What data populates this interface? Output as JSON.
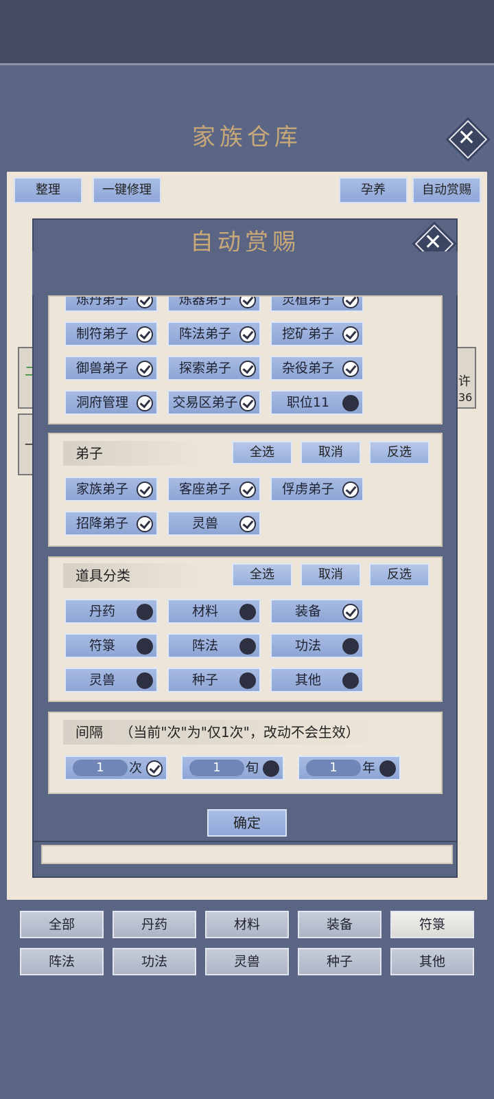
{
  "warehouse": {
    "title": "家族仓库",
    "toolbar": {
      "tidy": "整理",
      "repair": "一键修理",
      "breed": "孕养",
      "auto_reward": "自动赏赐"
    },
    "behind_text": {
      "left1": "二",
      "left2": "一",
      "right1": "许",
      "right2": "36"
    },
    "tabs_row1": [
      "全部",
      "丹药",
      "材料",
      "装备",
      "符箓"
    ],
    "tabs_row2": [
      "阵法",
      "功法",
      "灵兽",
      "种子",
      "其他"
    ],
    "selected_tab": "符箓"
  },
  "dialog": {
    "title": "自动赏赐",
    "positions": [
      {
        "label": "炼丹弟子",
        "checked": true
      },
      {
        "label": "炼器弟子",
        "checked": true
      },
      {
        "label": "灵植弟子",
        "checked": true
      },
      {
        "label": "制符弟子",
        "checked": true
      },
      {
        "label": "阵法弟子",
        "checked": true
      },
      {
        "label": "挖矿弟子",
        "checked": true
      },
      {
        "label": "御兽弟子",
        "checked": true
      },
      {
        "label": "探索弟子",
        "checked": true
      },
      {
        "label": "杂役弟子",
        "checked": true
      },
      {
        "label": "洞府管理",
        "checked": true
      },
      {
        "label": "交易区弟子",
        "checked": true
      },
      {
        "label": "职位11",
        "checked": false
      }
    ],
    "disciples": {
      "header": "弟子",
      "select_all": "全选",
      "cancel": "取消",
      "invert": "反选",
      "items": [
        {
          "label": "家族弟子",
          "checked": true
        },
        {
          "label": "客座弟子",
          "checked": true
        },
        {
          "label": "俘虏弟子",
          "checked": true
        },
        {
          "label": "招降弟子",
          "checked": true
        },
        {
          "label": "灵兽",
          "checked": true
        }
      ]
    },
    "items": {
      "header": "道具分类",
      "select_all": "全选",
      "cancel": "取消",
      "invert": "反选",
      "categories": [
        {
          "label": "丹药",
          "checked": false
        },
        {
          "label": "材料",
          "checked": false
        },
        {
          "label": "装备",
          "checked": true
        },
        {
          "label": "符箓",
          "checked": false
        },
        {
          "label": "阵法",
          "checked": false
        },
        {
          "label": "功法",
          "checked": false
        },
        {
          "label": "灵兽",
          "checked": false
        },
        {
          "label": "种子",
          "checked": false
        },
        {
          "label": "其他",
          "checked": false
        }
      ]
    },
    "interval": {
      "header": "间隔",
      "note": "（当前\"次\"为\"仅1次\"，改动不会生效）",
      "options": [
        {
          "value": "1",
          "unit": "次",
          "checked": true
        },
        {
          "value": "1",
          "unit": "旬",
          "checked": false
        },
        {
          "value": "1",
          "unit": "年",
          "checked": false
        }
      ]
    },
    "confirm": "确定"
  }
}
